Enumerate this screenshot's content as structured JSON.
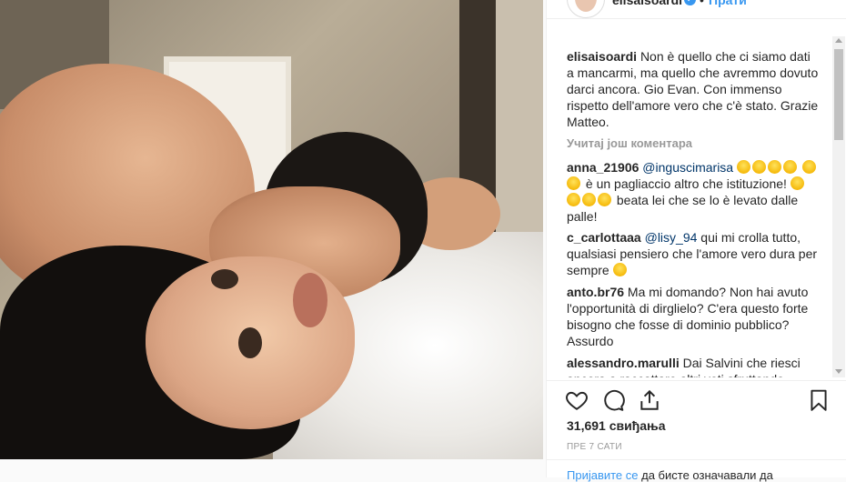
{
  "photo": {
    "description_icon": "post-photo"
  },
  "header": {
    "username": "elisaisoardi",
    "verified_icon": "verified-badge-icon",
    "separator": "•",
    "follow_label": "Прати"
  },
  "caption": {
    "user": "elisaisoardi",
    "text": "Non è quello che ci siamo dati a mancarmi, ma quello che avremmo dovuto darci ancora. Gio Evan. Con immenso rispetto dell'amore vero che c'è stato. Grazie Matteo."
  },
  "load_more": "Учитај још коментара",
  "comments": [
    {
      "user": "anna_21906",
      "mention": "@inguscimarisa",
      "part1": "è un pagliaccio altro che istituzione!",
      "part2": "beata lei che se lo è levato dalle palle!"
    },
    {
      "user": "c_carlottaaa",
      "mention": "@lisy_94",
      "text": "qui mi crolla tutto, qualsiasi pensiero che l'amore vero dura per sempre"
    },
    {
      "user": "anto.br76",
      "text": "Ma mi domando? Non hai avuto l'opportunità di dirglielo? C'era questo forte bisogno che fosse di dominio pubblico? Assurdo"
    },
    {
      "user": "alessandro.marulli",
      "text": "Dai Salvini che riesci ancora a raccattare altri voti sfruttando"
    }
  ],
  "actions": {
    "like_icon": "heart-icon",
    "comment_icon": "comment-icon",
    "share_icon": "share-icon",
    "save_icon": "bookmark-icon"
  },
  "likes": "31,691 свиђања",
  "timestamp": "ПРЕ 7 САТИ",
  "login": {
    "link": "Пријавите се",
    "text": " да бисте означавали да"
  }
}
